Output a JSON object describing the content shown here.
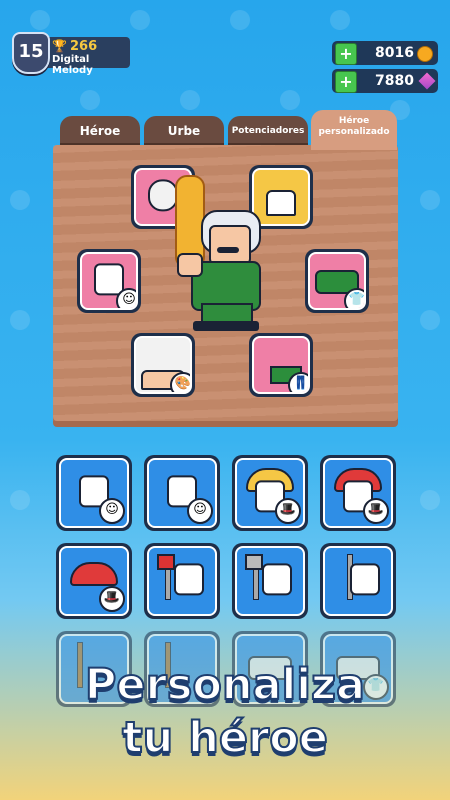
{
  "hud": {
    "level": "15",
    "trophies": "266",
    "player_name": "Digital Melody",
    "gold": "8016",
    "gems": "7880",
    "plus_label": "+",
    "trophy_icon": "trophy-icon",
    "coin_icon": "coin-icon",
    "gem_icon": "gem-icon"
  },
  "tabs": [
    {
      "label": "Héroe"
    },
    {
      "label": "Urbe"
    },
    {
      "label": "Potenciadores"
    },
    {
      "label": "Héroe personalizado"
    }
  ],
  "headline": {
    "line1": "Personaliza",
    "line2": "tu héroe"
  },
  "colors": {
    "accent_pink": "#ef7fa6",
    "accent_gold": "#f5c745",
    "accent_blue": "#2f8ee6",
    "board": "#c68a6a"
  }
}
